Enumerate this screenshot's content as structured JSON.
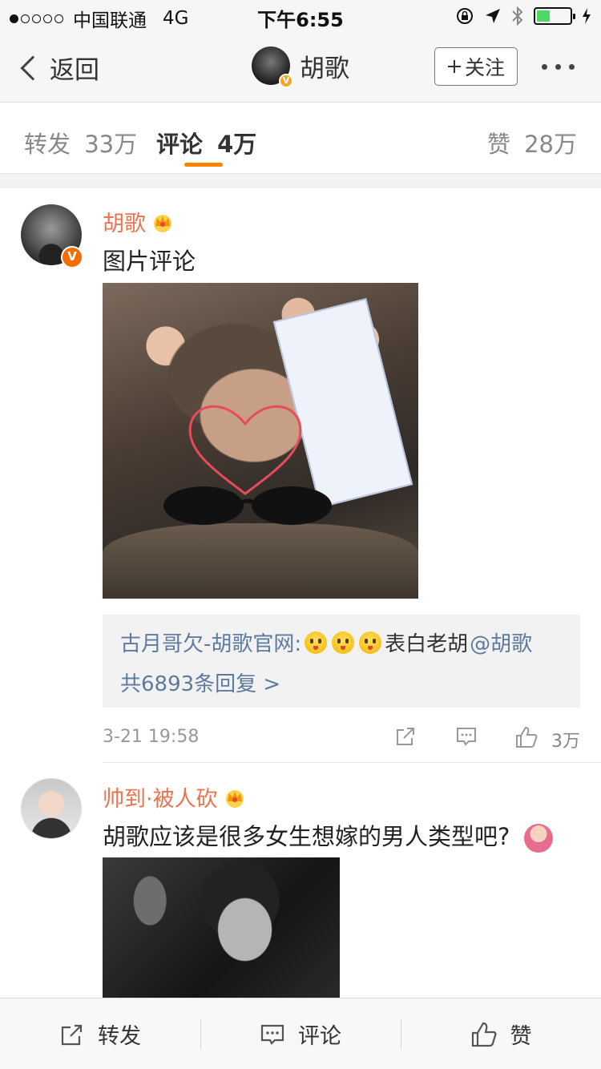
{
  "status_bar": {
    "carrier": "中国联通",
    "network": "4G",
    "time": "下午6:55",
    "battery_level": 0.4
  },
  "nav": {
    "back_label": "返回",
    "title": "胡歌",
    "follow_label": "关注",
    "verified_mark": "V"
  },
  "tabs": {
    "repost_label": "转发",
    "repost_count": "33万",
    "comment_label": "评论",
    "comment_count": "4万",
    "like_label": "赞",
    "like_count": "28万"
  },
  "comments": [
    {
      "user": "胡歌",
      "text": "图片评论",
      "verified_mark": "V",
      "reply": {
        "author": "古月哥欠-胡歌官网:",
        "text": "表白老胡",
        "mention": "@胡歌",
        "more": "共6893条回复 >"
      },
      "date": "3-21 19:58",
      "likes": "3万"
    },
    {
      "user": "帅到·被人砍",
      "text": "胡歌应该是很多女生想嫁的男人类型吧?"
    }
  ],
  "toolbar": {
    "repost": "转发",
    "comment": "评论",
    "like": "赞"
  },
  "colors": {
    "accent": "#ff8200",
    "username": "#eb7350",
    "link": "#5d7a9f"
  }
}
